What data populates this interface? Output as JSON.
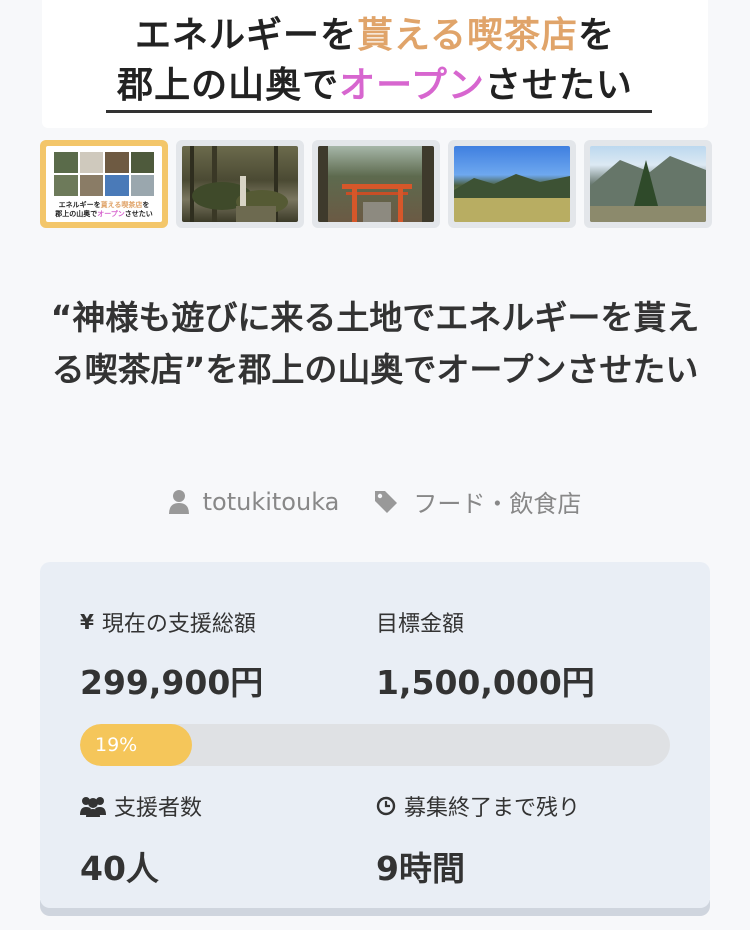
{
  "hero": {
    "line1_a": "エネルギーを",
    "line1_b": "貰える喫茶店",
    "line1_c": "を",
    "line2_a": "郡上の山奥で",
    "line2_b": "オープン",
    "line2_c": "させたい",
    "colors": {
      "accent_orange": "#e0a46a",
      "accent_pink": "#d766cf"
    }
  },
  "thumbnails": [
    {
      "name": "thumb-cover",
      "caption_a": "エネルギーを",
      "caption_b": "貰える喫茶店",
      "caption_c": "を",
      "caption_d": "郡上の山奥で",
      "caption_e": "オープン",
      "caption_f": "させたい",
      "active": true
    },
    {
      "name": "thumb-forest-stones",
      "active": false
    },
    {
      "name": "thumb-torii-gate",
      "active": false
    },
    {
      "name": "thumb-mountains-field",
      "active": false
    },
    {
      "name": "thumb-mountain-tree",
      "active": false
    }
  ],
  "project": {
    "title": "“神様も遊びに来る土地でエネルギーを貰える喫茶店”を郡上の山奥でオープンさせたい",
    "author": "totukitouka",
    "category": "フード・飲食店",
    "author_icon": "user-icon",
    "category_icon": "tag-icon"
  },
  "stats": {
    "raised_label": "現在の支援総額",
    "raised_icon_glyph": "¥",
    "raised_value": "299,900円",
    "goal_label": "目標金額",
    "goal_value": "1,500,000円",
    "progress_percent": 19,
    "progress_text": "19%",
    "backers_label": "支援者数",
    "backers_icon": "users-icon",
    "backers_value": "40人",
    "remaining_label": "募集終了まで残り",
    "remaining_icon": "clock-icon",
    "remaining_value": "9時間",
    "colors": {
      "panel": "#e9eef5",
      "progress_fill": "#f5c65a",
      "progress_track": "#dfe1e4"
    }
  }
}
